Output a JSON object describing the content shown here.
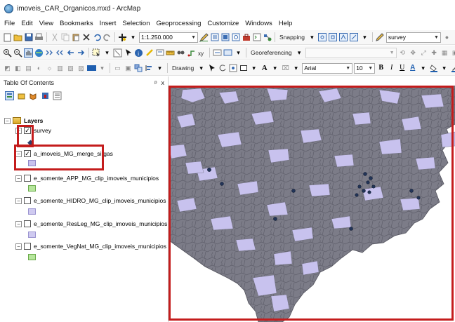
{
  "window": {
    "title": "imoveis_CAR_Organicos.mxd - ArcMap"
  },
  "menu": [
    "File",
    "Edit",
    "View",
    "Bookmarks",
    "Insert",
    "Selection",
    "Geoprocessing",
    "Customize",
    "Windows",
    "Help"
  ],
  "toolbar": {
    "scale": "1:1.250.000",
    "snapping_label": "Snapping",
    "target_layer": "survey",
    "georeferencing_label": "Georeferencing",
    "drawing_label": "Drawing",
    "font_name": "Arial",
    "font_size": "10",
    "bold": "B",
    "italic": "I",
    "underline": "U",
    "font_color_glyph": "A"
  },
  "toc": {
    "title": "Table Of Contents",
    "pin_glyph": "ᵖ",
    "close_glyph": "x",
    "root_label": "Layers",
    "layers": [
      {
        "name": "survey",
        "checked": true,
        "symbol_color": "#2b3f6b"
      },
      {
        "name": "a_imoveis_MG_merge_sirgas",
        "checked": true,
        "symbol_color": "#c8c2ee"
      },
      {
        "name": "e_somente_APP_MG_clip_imoveis_municipios",
        "checked": false,
        "symbol_color": "#b6e69c"
      },
      {
        "name": "e_somente_HIDRO_MG_clip_imoveis_municipios",
        "checked": false,
        "symbol_color": "#cfcaf0"
      },
      {
        "name": "e_somente_ResLeg_MG_clip_imoveis_municipios",
        "checked": false,
        "symbol_color": "#cfcaf0"
      },
      {
        "name": "e_somente_VegNat_MG_clip_imoveis_municipios",
        "checked": false,
        "symbol_color": "#b6e69c"
      }
    ]
  },
  "map": {
    "parcel_fill": "#c8c2ee",
    "parcel_outline": "#6a6a78",
    "point_color": "#223458",
    "highlight_color": "#c41c1c"
  }
}
